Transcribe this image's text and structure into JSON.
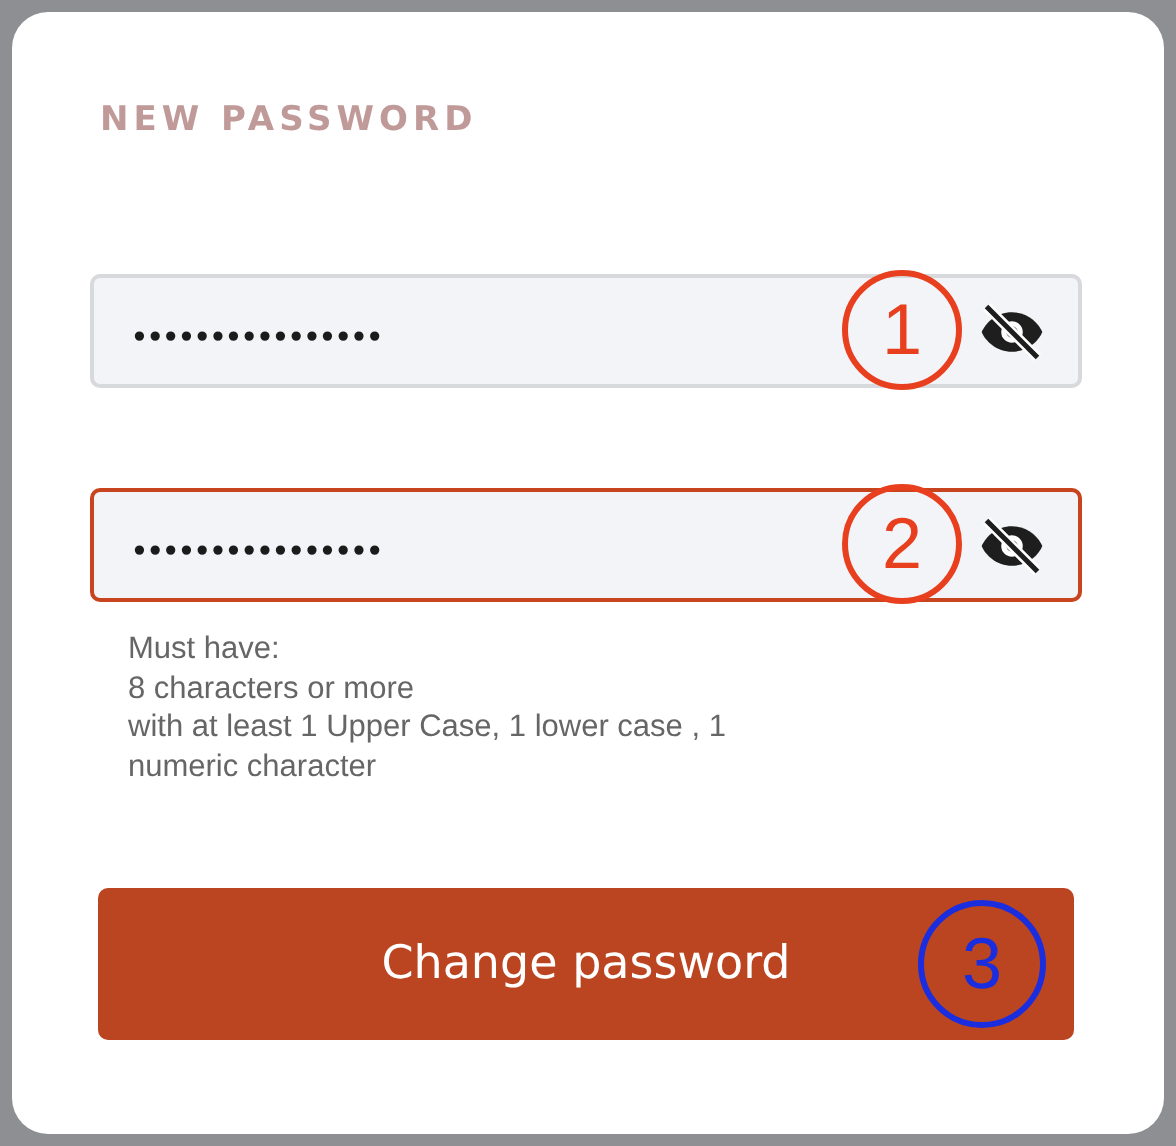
{
  "title": "NEW PASSWORD",
  "fields": [
    {
      "value": "••••••••••••••••",
      "error": false,
      "marker": {
        "label": "1",
        "color": "#e8401f"
      }
    },
    {
      "value": "••••••••••••••••",
      "error": true,
      "marker": {
        "label": "2",
        "color": "#e8401f"
      }
    }
  ],
  "hint_lines": [
    "Must have:",
    "8 characters or more",
    "with at least 1 Upper Case, 1 lower case , 1",
    "numeric character"
  ],
  "button": {
    "label": "Change password",
    "marker": {
      "label": "3",
      "color": "#1a2ee0"
    }
  }
}
